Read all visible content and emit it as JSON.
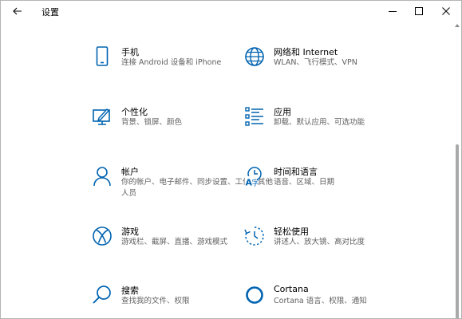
{
  "window": {
    "title": "设置"
  },
  "colors": {
    "accent": "#0063b1",
    "text": "#000000",
    "secondary_text": "#5f5f5f",
    "scroll_thumb": "#a9a9a9"
  },
  "tiles": [
    {
      "title": "手机",
      "desc": "连接 Android 设备和 iPhone",
      "icon": "phone-icon"
    },
    {
      "title": "网络和 Internet",
      "desc": "WLAN、飞行模式、VPN",
      "icon": "globe-icon"
    },
    {
      "title": "个性化",
      "desc": "背景、锁屏、颜色",
      "icon": "personalization-icon"
    },
    {
      "title": "应用",
      "desc": "卸载、默认应用、可选功能",
      "icon": "apps-list-icon"
    },
    {
      "title": "帐户",
      "desc": "你的帐户、电子邮件、同步设置、工作、其他人员",
      "icon": "person-icon"
    },
    {
      "title": "时间和语言",
      "desc": "语音、区域、日期",
      "icon": "time-language-icon"
    },
    {
      "title": "游戏",
      "desc": "游戏栏、截屏、直播、游戏模式",
      "icon": "xbox-icon"
    },
    {
      "title": "轻松使用",
      "desc": "讲述人、放大镜、高对比度",
      "icon": "ease-of-access-icon"
    },
    {
      "title": "搜索",
      "desc": "查找我的文件、权限",
      "icon": "search-icon"
    },
    {
      "title": "Cortana",
      "desc": "Cortana 语言、权限、通知",
      "icon": "cortana-icon"
    }
  ]
}
